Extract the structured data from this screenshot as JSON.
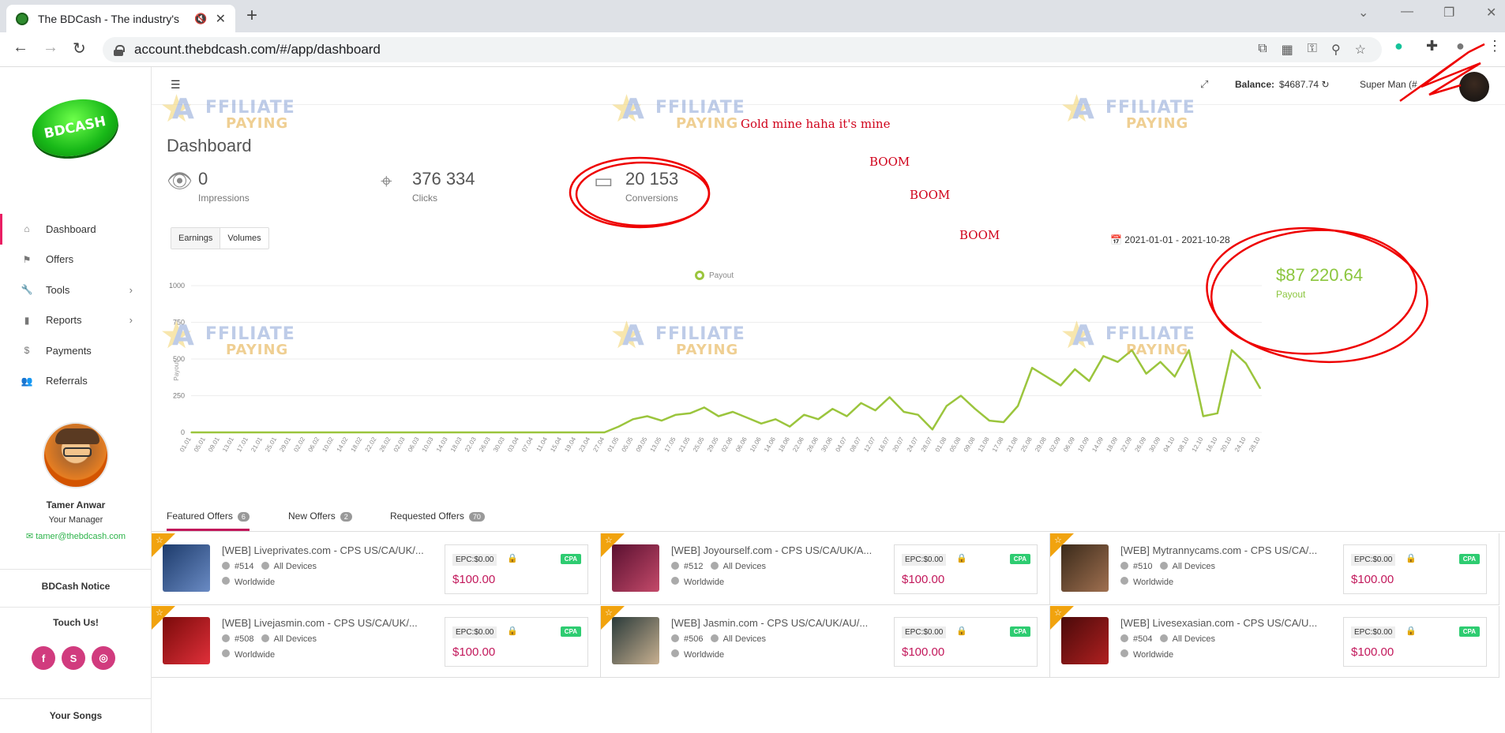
{
  "browser": {
    "tab_title": "The BDCash - The industry's",
    "url": "account.thebdcash.com/#/app/dashboard"
  },
  "logo": {
    "text": "BDCASH"
  },
  "sidebar": {
    "items": [
      {
        "label": "Dashboard",
        "icon": "home-icon",
        "active": true
      },
      {
        "label": "Offers",
        "icon": "flag-icon"
      },
      {
        "label": "Tools",
        "icon": "wrench-icon",
        "arrow": true
      },
      {
        "label": "Reports",
        "icon": "bar-chart-icon",
        "arrow": true
      },
      {
        "label": "Payments",
        "icon": "dollar-icon"
      },
      {
        "label": "Referrals",
        "icon": "users-icon"
      }
    ],
    "manager": {
      "name": "Tamer Anwar",
      "role": "Your Manager",
      "email": "tamer@thebdcash.com"
    },
    "notice": "BDCash Notice",
    "touch": "Touch Us!",
    "social": [
      "f",
      "S",
      "◎"
    ],
    "songs": "Your Songs"
  },
  "header": {
    "balance_label": "Balance:",
    "balance_value": "$4687.74",
    "user": "Super Man (#"
  },
  "page": {
    "title": "Dashboard",
    "stats": [
      {
        "value": "0",
        "label": "Impressions",
        "icon": "eye-icon"
      },
      {
        "value": "376 334",
        "label": "Clicks",
        "icon": "crosshair-icon"
      },
      {
        "value": "20 153",
        "label": "Conversions",
        "icon": "wallet-icon"
      }
    ],
    "segments": [
      "Earnings",
      "Volumes"
    ],
    "date_range": "2021-01-01 - 2021-10-28",
    "legend": "Payout",
    "payout_value": "$87 220.64",
    "payout_label": "Payout"
  },
  "annotations": {
    "gold": "Gold mine haha it's mine",
    "boom": "BOOM"
  },
  "watermark": {
    "a": "A",
    "ffiliate": "FFILIATE",
    "paying": "PAYING"
  },
  "chart_data": {
    "type": "line",
    "title": "",
    "xlabel": "",
    "ylabel": "Payout",
    "ylim": [
      0,
      1000
    ],
    "yticks": [
      "0",
      "250",
      "500",
      "750",
      "1000"
    ],
    "x": [
      "01.01",
      "05.01",
      "09.01",
      "13.01",
      "17.01",
      "21.01",
      "25.01",
      "29.01",
      "02.02",
      "06.02",
      "10.02",
      "14.02",
      "18.02",
      "22.02",
      "26.02",
      "02.03",
      "06.03",
      "10.03",
      "14.03",
      "18.03",
      "22.03",
      "26.03",
      "30.03",
      "03.04",
      "07.04",
      "11.04",
      "15.04",
      "19.04",
      "23.04",
      "27.04",
      "01.05",
      "05.05",
      "09.05",
      "13.05",
      "17.05",
      "21.05",
      "25.05",
      "29.05",
      "02.06",
      "06.06",
      "10.06",
      "14.06",
      "18.06",
      "22.06",
      "26.06",
      "30.06",
      "04.07",
      "08.07",
      "12.07",
      "16.07",
      "20.07",
      "24.07",
      "28.07",
      "01.08",
      "05.08",
      "09.08",
      "13.08",
      "17.08",
      "21.08",
      "25.08",
      "29.08",
      "02.09",
      "06.09",
      "10.09",
      "14.09",
      "18.09",
      "22.09",
      "26.09",
      "30.09",
      "04.10",
      "08.10",
      "12.10",
      "16.10",
      "20.10",
      "24.10",
      "28.10"
    ],
    "series": [
      {
        "name": "Payout",
        "values": [
          0,
          0,
          0,
          0,
          0,
          0,
          0,
          0,
          0,
          0,
          0,
          0,
          0,
          0,
          0,
          0,
          0,
          0,
          0,
          0,
          0,
          0,
          0,
          0,
          0,
          0,
          0,
          0,
          0,
          0,
          40,
          90,
          110,
          80,
          120,
          130,
          170,
          110,
          140,
          100,
          60,
          90,
          40,
          120,
          90,
          160,
          110,
          200,
          150,
          240,
          140,
          120,
          20,
          180,
          250,
          160,
          80,
          70,
          180,
          440,
          380,
          320,
          430,
          350,
          520,
          480,
          560,
          400,
          480,
          380,
          560,
          110,
          130,
          560,
          470,
          300
        ]
      }
    ]
  }
}
